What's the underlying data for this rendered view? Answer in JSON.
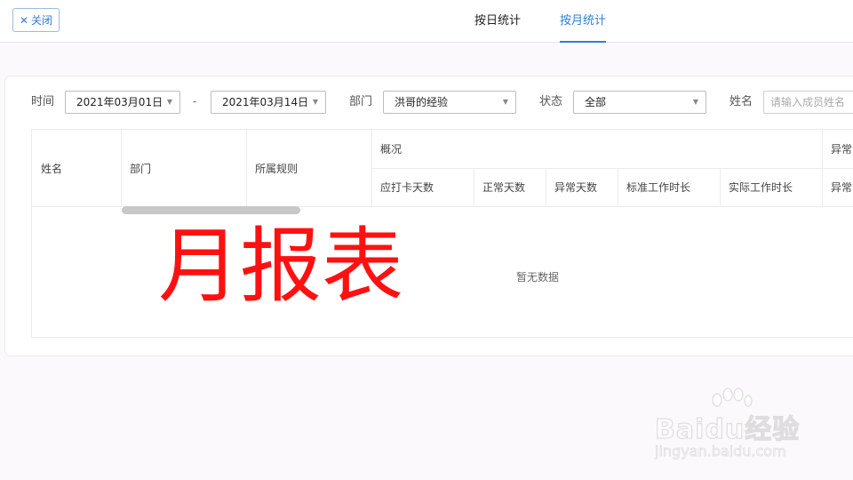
{
  "header": {
    "close_label": "关闭",
    "tabs": [
      {
        "label": "按日统计",
        "active": false
      },
      {
        "label": "按月统计",
        "active": true
      }
    ],
    "accent_color": "#2f7ed8"
  },
  "filters": {
    "time_label": "时间",
    "start_date": "2021年03月01日",
    "separator": "-",
    "end_date": "2021年03月14日",
    "dept_label": "部门",
    "dept_value": "洪哥的经验",
    "status_label": "状态",
    "status_value": "全部",
    "name_label": "姓名",
    "name_placeholder": "请输入成员姓名"
  },
  "table": {
    "columns": {
      "name": "姓名",
      "dept": "部门",
      "rule": "所属规则",
      "overview": "概况",
      "abnormal": "异常",
      "sub": [
        "应打卡天数",
        "正常天数",
        "异常天数",
        "标准工作时长",
        "实际工作时长",
        "异常"
      ]
    },
    "empty_text": "暂无数据"
  },
  "overlay_title": "月报表",
  "watermark": {
    "main": "Baidu经验",
    "sub": "jingyan.baidu.com"
  }
}
